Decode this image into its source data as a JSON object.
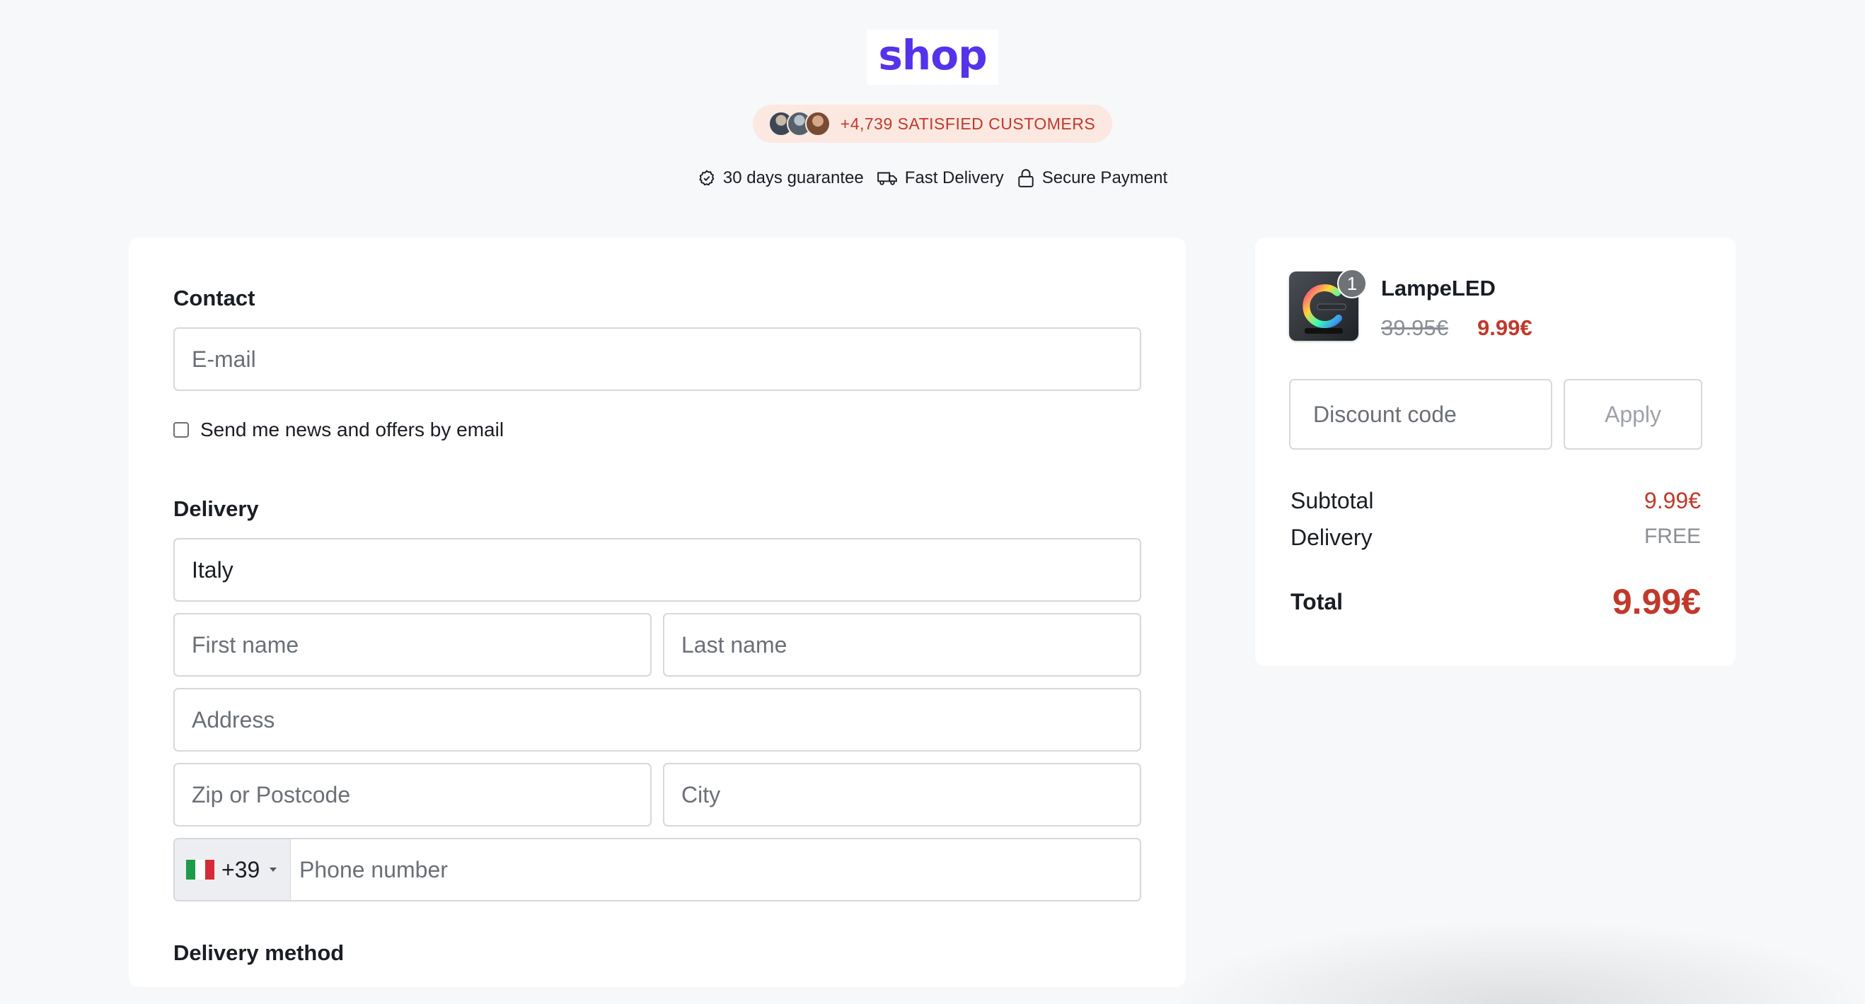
{
  "brand": {
    "logo_text": "shop",
    "color": "#5433eb"
  },
  "social_proof": {
    "text": "+4,739 SATISFIED CUSTOMERS",
    "text_color": "#c0392b"
  },
  "badges": [
    {
      "icon": "badge-check-icon",
      "label": "30 days guarantee"
    },
    {
      "icon": "truck-icon",
      "label": "Fast Delivery"
    },
    {
      "icon": "lock-icon",
      "label": "Secure Payment"
    }
  ],
  "contact": {
    "title": "Contact",
    "email_placeholder": "E-mail",
    "newsletter_label": "Send me news and offers by email",
    "newsletter_checked": false
  },
  "delivery": {
    "title": "Delivery",
    "country": "Italy",
    "first_name_placeholder": "First name",
    "last_name_placeholder": "Last name",
    "address_placeholder": "Address",
    "zip_placeholder": "Zip or Postcode",
    "city_placeholder": "City",
    "phone_prefix": "+39",
    "phone_flag": "italy-flag-icon",
    "phone_placeholder": "Phone number"
  },
  "delivery_method": {
    "title": "Delivery method"
  },
  "order": {
    "product_name": "LampeLED",
    "quantity": "1",
    "old_price": "39.95€",
    "new_price": "9.99€",
    "discount_placeholder": "Discount code",
    "apply_label": "Apply",
    "subtotal_label": "Subtotal",
    "subtotal_value": "9.99€",
    "delivery_label": "Delivery",
    "delivery_value": "FREE",
    "total_label": "Total",
    "total_value": "9.99€"
  }
}
